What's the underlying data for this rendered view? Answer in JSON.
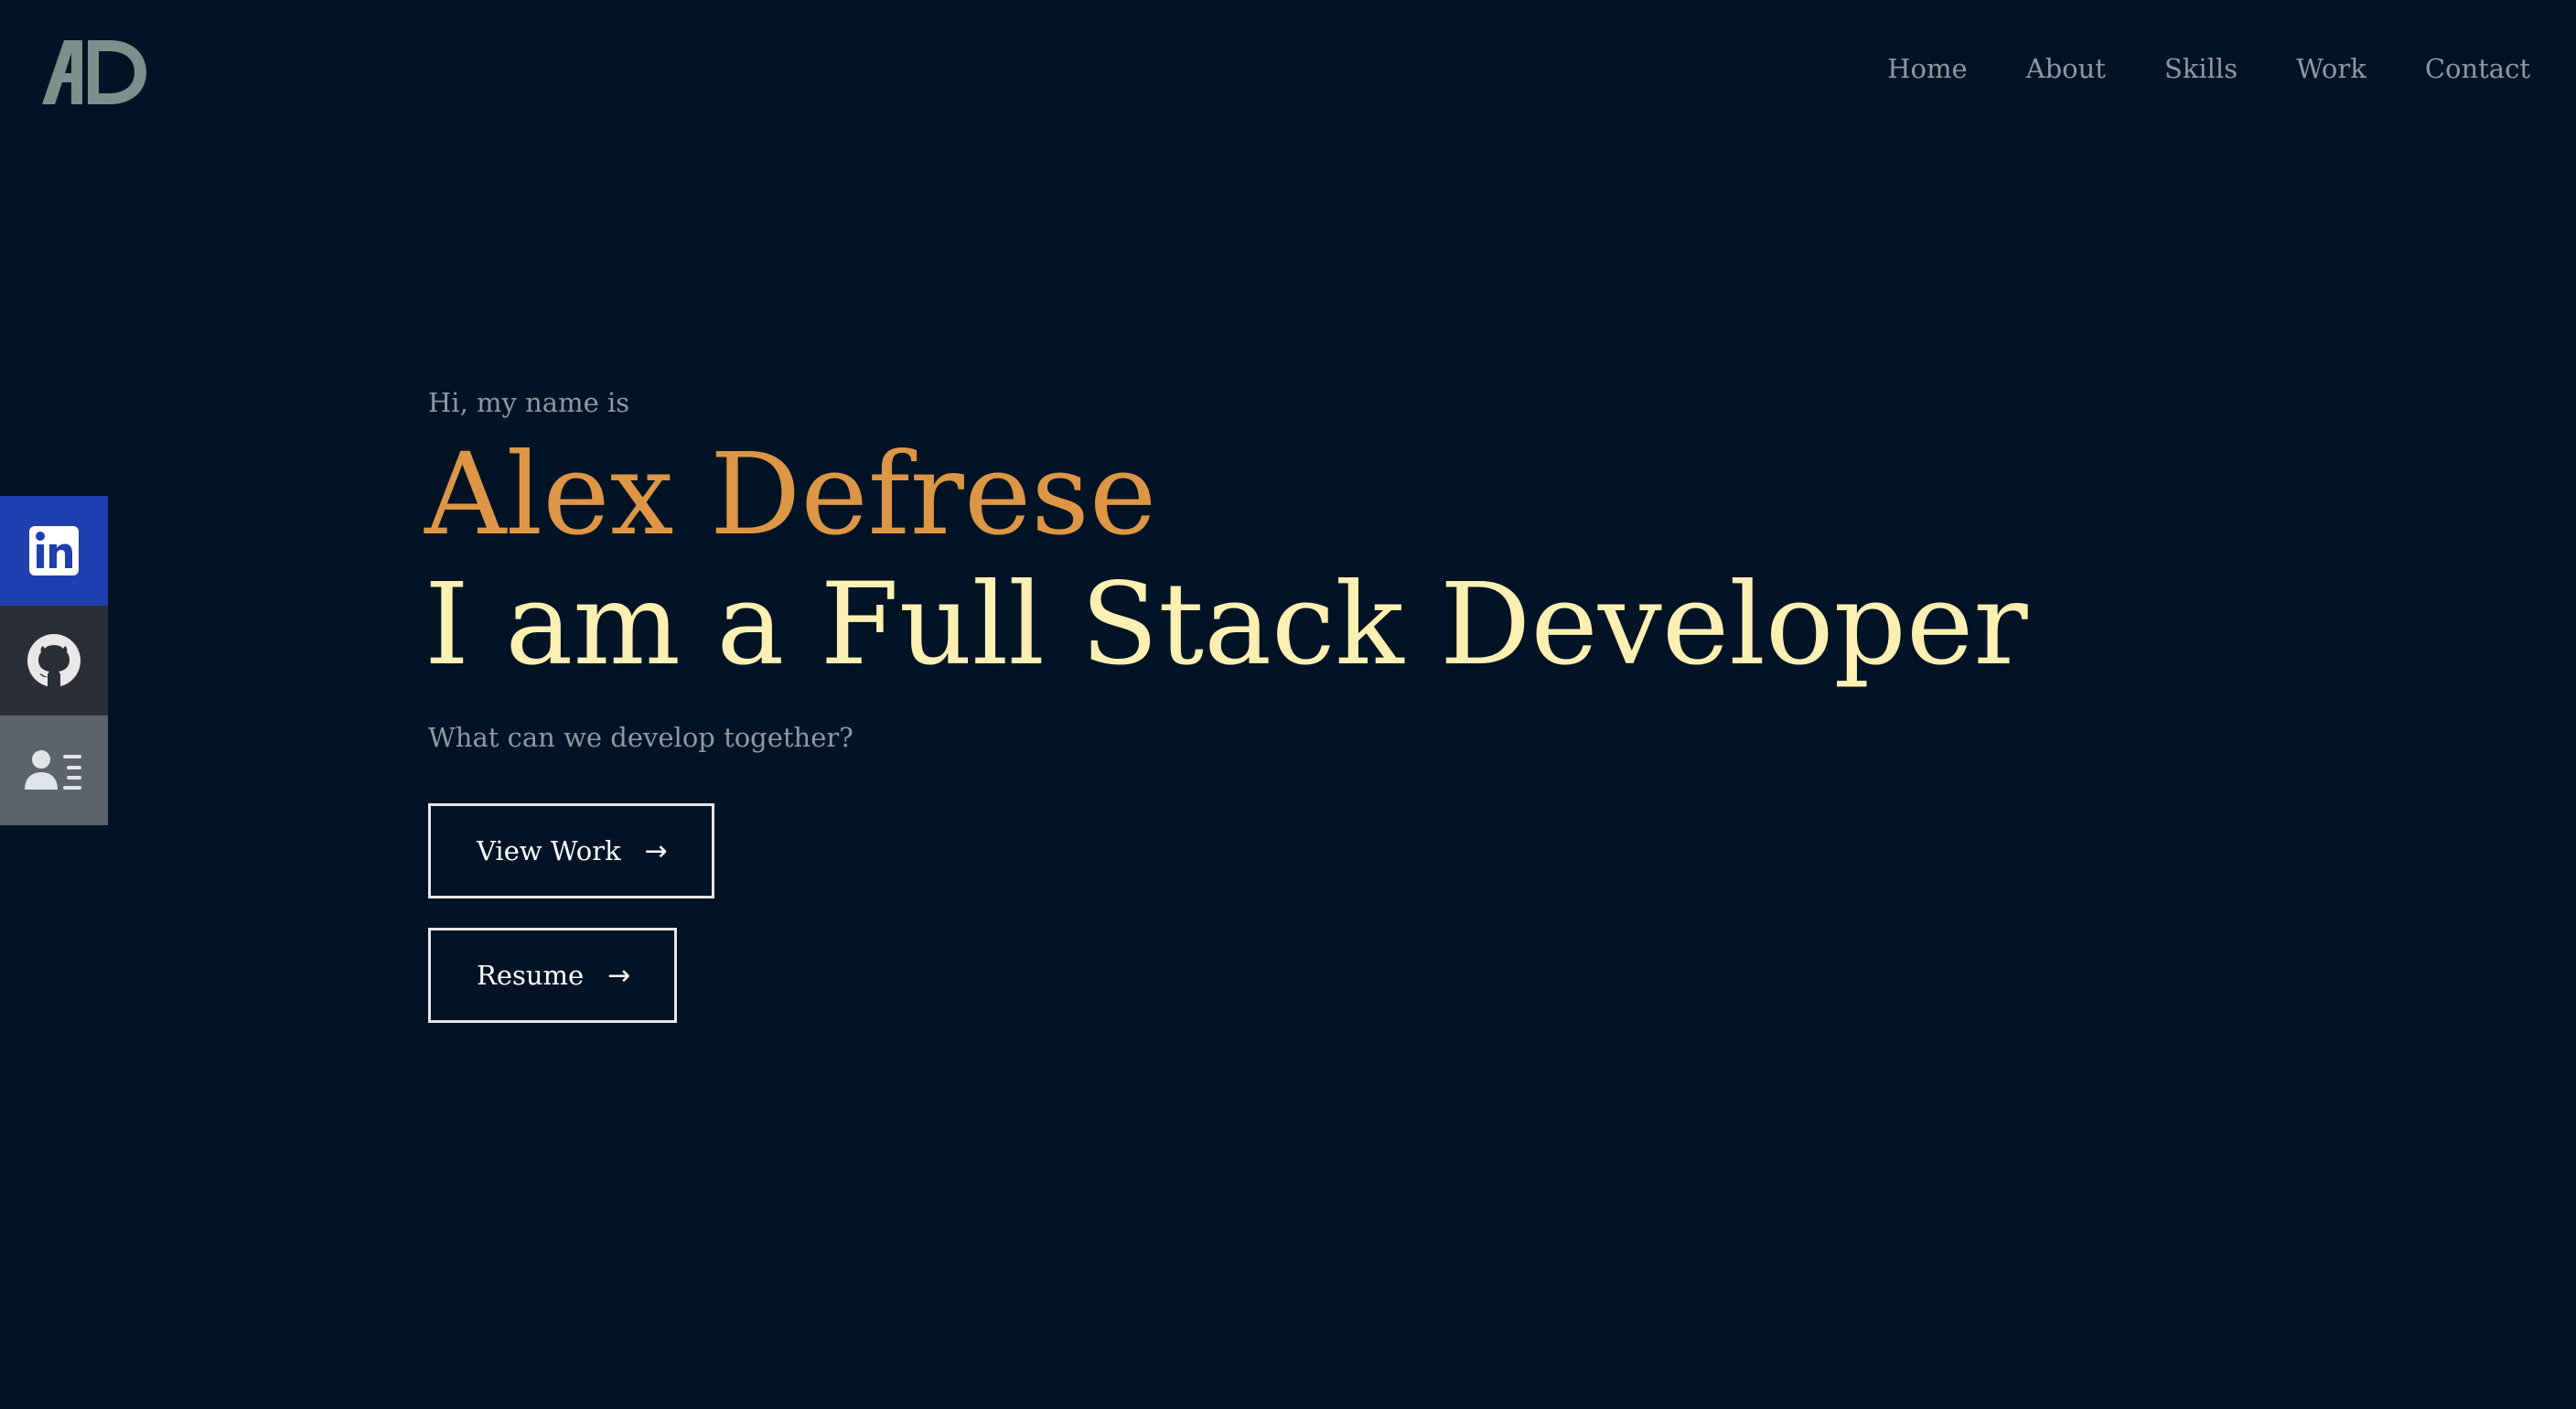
{
  "brand": {
    "logo_text": "AD",
    "logo_color": "#7a928b"
  },
  "nav": {
    "items": [
      "Home",
      "About",
      "Skills",
      "Work",
      "Contact"
    ]
  },
  "social": {
    "items": [
      {
        "icon": "linkedin-icon",
        "color": "#1f3eb0"
      },
      {
        "icon": "github-icon",
        "color": "#2b2f35"
      },
      {
        "icon": "resume-icon",
        "color": "#5c636b"
      }
    ]
  },
  "hero": {
    "greeting": "Hi, my name is",
    "name": "Alex Defrese",
    "role": "I am a Full Stack Developer",
    "tagline": "What can we develop together?",
    "view_work_label": "View Work",
    "resume_label": "Resume",
    "arrow": "→"
  },
  "colors": {
    "background": "#011325",
    "name_accent": "#dd9645",
    "role_accent": "#fcefb2",
    "muted_text": "#8b9ba1"
  }
}
